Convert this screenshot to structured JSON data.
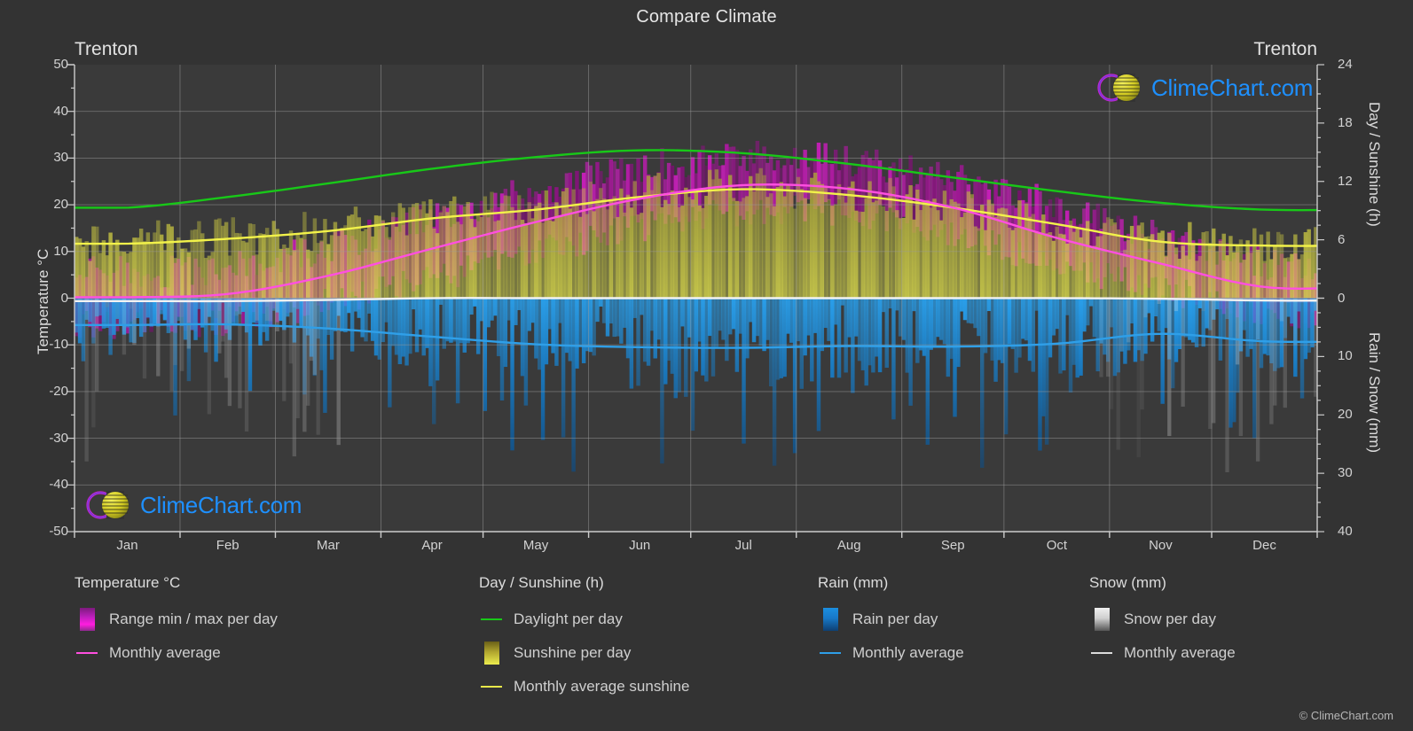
{
  "header": {
    "title": "Compare Climate",
    "location_left": "Trenton",
    "location_right": "Trenton"
  },
  "axes": {
    "left_title": "Temperature °C",
    "right_top_title": "Day / Sunshine (h)",
    "right_bottom_title": "Rain / Snow (mm)",
    "left_ticks": [
      "50",
      "40",
      "30",
      "20",
      "10",
      "0",
      "-10",
      "-20",
      "-30",
      "-40",
      "-50"
    ],
    "right_ticks": [
      "24",
      "18",
      "12",
      "6",
      "0",
      "10",
      "20",
      "30",
      "40"
    ],
    "months": [
      "Jan",
      "Feb",
      "Mar",
      "Apr",
      "May",
      "Jun",
      "Jul",
      "Aug",
      "Sep",
      "Oct",
      "Nov",
      "Dec"
    ]
  },
  "legend": {
    "groups": [
      {
        "heading": "Temperature °C",
        "items": [
          {
            "label": "Range min / max per day",
            "key": "swatch",
            "style": "sw-temp"
          },
          {
            "label": "Monthly average",
            "key": "line",
            "color": "#ff4fe0"
          }
        ]
      },
      {
        "heading": "Day / Sunshine (h)",
        "items": [
          {
            "label": "Daylight per day",
            "key": "line",
            "color": "#18c818"
          },
          {
            "label": "Sunshine per day",
            "key": "swatch",
            "style": "sw-sun"
          },
          {
            "label": "Monthly average sunshine",
            "key": "line",
            "color": "#e8e84a"
          }
        ]
      },
      {
        "heading": "Rain (mm)",
        "items": [
          {
            "label": "Rain per day",
            "key": "swatch",
            "style": "sw-rain"
          },
          {
            "label": "Monthly average",
            "key": "line",
            "color": "#2f9fe8"
          }
        ]
      },
      {
        "heading": "Snow (mm)",
        "items": [
          {
            "label": "Snow per day",
            "key": "swatch",
            "style": "sw-snow"
          },
          {
            "label": "Monthly average",
            "key": "line",
            "color": "#dcdcdc"
          }
        ]
      }
    ]
  },
  "branding": {
    "name": "ClimeChart.com",
    "copyright": "© ClimeChart.com"
  },
  "colors": {
    "background": "#333333",
    "plot_background": "#3a3a3a",
    "grid": "#8f8f8f",
    "axis": "#cccccc",
    "text": "#d8d8d8",
    "daylight": "#18c818",
    "sunshine_line": "#f2f24a",
    "temp_avg": "#ff4fe0",
    "rain_avg": "#2f9fe8",
    "snow_avg": "#f2f2f2",
    "temp_band": "#cc22bb",
    "sunshine_band": "#b9b03a",
    "rain_band": "#1d7ec4",
    "brand_blue": "#1e90ff",
    "brand_magenta": "#d01fd0",
    "brand_yellow": "#d4cc22"
  },
  "chart_data": {
    "type": "area",
    "title": "Compare Climate",
    "xlabel": "",
    "ylabel": "Temperature °C",
    "y2label_top": "Day / Sunshine (h)",
    "y2label_bottom": "Rain / Snow (mm)",
    "grid": true,
    "legend_position": "bottom",
    "categories": [
      "Jan",
      "Feb",
      "Mar",
      "Apr",
      "May",
      "Jun",
      "Jul",
      "Aug",
      "Sep",
      "Oct",
      "Nov",
      "Dec"
    ],
    "ylim_temperature": [
      -50,
      50
    ],
    "ylim_day_sunshine": [
      0,
      24
    ],
    "ylim_rain_snow": [
      0,
      40
    ],
    "series": [
      {
        "name": "Daylight per day",
        "unit": "h",
        "axis": "day_sunshine",
        "color": "#18c818",
        "values": [
          9.3,
          10.4,
          11.8,
          13.3,
          14.5,
          15.2,
          14.9,
          13.8,
          12.4,
          11.0,
          9.8,
          9.1
        ]
      },
      {
        "name": "Monthly average sunshine",
        "unit": "h",
        "axis": "day_sunshine",
        "color": "#f2f24a",
        "values": [
          5.6,
          6.1,
          6.9,
          8.2,
          9.1,
          10.4,
          11.2,
          10.6,
          9.3,
          7.6,
          5.8,
          5.4
        ]
      },
      {
        "name": "Monthly average temperature",
        "unit": "°C",
        "axis": "temperature",
        "color": "#ff4fe0",
        "values": [
          0.2,
          0.9,
          4.8,
          10.6,
          16.3,
          21.3,
          24.2,
          23.4,
          19.4,
          12.9,
          7.4,
          2.4
        ]
      },
      {
        "name": "Rain monthly average",
        "unit": "mm",
        "axis": "rain_snow",
        "color": "#2f9fe8",
        "values": [
          4.6,
          4.5,
          5.2,
          6.6,
          7.9,
          8.4,
          8.5,
          8.2,
          8.3,
          7.8,
          6.1,
          7.4
        ]
      },
      {
        "name": "Snow monthly average",
        "unit": "mm",
        "axis": "rain_snow",
        "color": "#f2f2f2",
        "values": [
          0.5,
          0.5,
          0.3,
          0.0,
          0.0,
          0.0,
          0.0,
          0.0,
          0.0,
          0.0,
          0.1,
          0.4
        ]
      },
      {
        "name": "Temperature range min / max per day",
        "unit": "°C",
        "axis": "temperature",
        "color": "#cc22bb",
        "min": [
          -5.2,
          -4.6,
          -0.4,
          4.6,
          10.3,
          15.6,
          18.9,
          18.2,
          14.0,
          7.4,
          2.5,
          -2.6
        ],
        "max": [
          5.0,
          6.2,
          10.6,
          17.0,
          22.4,
          27.2,
          29.8,
          28.7,
          25.0,
          18.8,
          12.2,
          6.9
        ]
      },
      {
        "name": "Sunshine per day",
        "unit": "h",
        "axis": "day_sunshine",
        "color": "#b9b03a",
        "values": [
          5.6,
          6.1,
          6.9,
          8.2,
          9.1,
          10.4,
          11.2,
          10.6,
          9.3,
          7.6,
          5.8,
          5.4
        ]
      },
      {
        "name": "Rain per day",
        "unit": "mm",
        "axis": "rain_snow",
        "color": "#1d7ec4",
        "values": [
          4.6,
          4.5,
          5.2,
          6.6,
          7.9,
          8.4,
          8.5,
          8.2,
          8.3,
          7.8,
          6.1,
          7.4
        ]
      }
    ]
  }
}
